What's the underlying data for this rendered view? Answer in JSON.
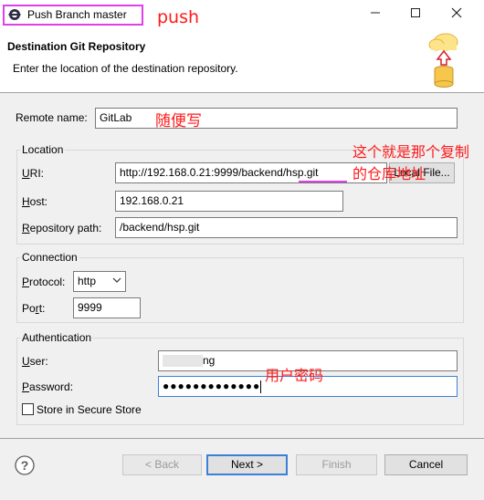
{
  "window": {
    "title": "Push Branch master",
    "minimize_icon": "minimize-icon",
    "maximize_icon": "maximize-icon",
    "close_icon": "close-icon",
    "highlight_color": "#e040e8"
  },
  "annotations": {
    "push": "push",
    "remote_name_note": "随便写",
    "uri_note": "这个就是那个复制的仓库地址",
    "password_note": "用户密码",
    "color": "#ff1a1a"
  },
  "header": {
    "title": "Destination Git Repository",
    "description": "Enter the location of the destination repository.",
    "banner_icon": "cloud-upload-database-icon"
  },
  "remote_name": {
    "label": "Remote name:",
    "value": "GitLab"
  },
  "location": {
    "group_title": "Location",
    "uri_label": "URI:",
    "uri_value": "http://192.168.0.21:9999/backend/hsp.git",
    "local_file_button": "Local File...",
    "host_label": "Host:",
    "host_value": "192.168.0.21",
    "repo_path_label": "Repository path:",
    "repo_path_value": "/backend/hsp.git"
  },
  "connection": {
    "group_title": "Connection",
    "protocol_label": "Protocol:",
    "protocol_value": "http",
    "port_label": "Port:",
    "port_value": "9999"
  },
  "authentication": {
    "group_title": "Authentication",
    "user_label": "User:",
    "user_value": "ng",
    "password_label": "Password:",
    "password_value": "●●●●●●●●●●●●●",
    "store_label": "Store in Secure Store",
    "store_checked": false
  },
  "footer": {
    "help_icon": "help-icon",
    "back": "< Back",
    "next": "Next >",
    "finish": "Finish",
    "cancel": "Cancel"
  }
}
